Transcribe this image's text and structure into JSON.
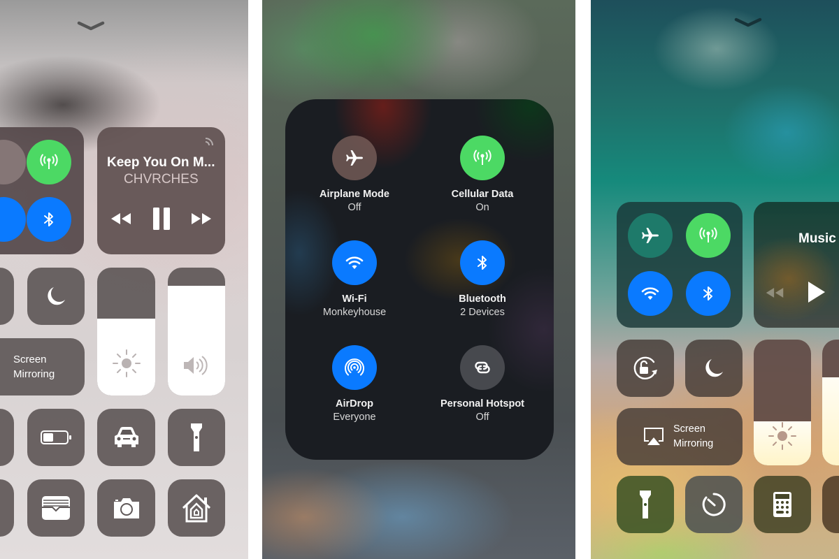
{
  "panels": {
    "left": {
      "connectivity": {
        "cellular_data": {
          "icon": "cellular-antenna-icon",
          "state": "on",
          "color": "#4cd964"
        },
        "bluetooth": {
          "icon": "bluetooth-icon",
          "state": "on",
          "color": "#0a7aff"
        }
      },
      "music": {
        "title": "Keep You On M...",
        "artist": "CHVRCHES",
        "controls": {
          "rewind": "rewind-icon",
          "pause": "pause-icon",
          "fast_forward": "fast-forward-icon",
          "airplay": "airplay-audio-icon"
        }
      },
      "do_not_disturb": {
        "icon": "moon-icon"
      },
      "screen_mirroring": {
        "line1": "Screen",
        "line2": "Mirroring"
      },
      "brightness": {
        "icon": "sun-icon",
        "level_percent": 60
      },
      "volume": {
        "icon": "speaker-icon",
        "level_percent": 86
      },
      "shortcuts": [
        {
          "name": "low-power-mode",
          "icon": "battery-icon"
        },
        {
          "name": "carplay-driving",
          "icon": "car-icon"
        },
        {
          "name": "flashlight",
          "icon": "flashlight-icon"
        },
        {
          "name": "wallet",
          "icon": "wallet-icon"
        },
        {
          "name": "camera",
          "icon": "camera-icon"
        },
        {
          "name": "home",
          "icon": "home-icon"
        }
      ]
    },
    "middle": {
      "items": [
        {
          "name": "Airplane Mode",
          "status": "Off",
          "icon": "airplane-icon",
          "color": "#6b6b70"
        },
        {
          "name": "Cellular Data",
          "status": "On",
          "icon": "cellular-antenna-icon",
          "color": "#4cd964"
        },
        {
          "name": "Wi-Fi",
          "status": "Monkeyhouse",
          "icon": "wifi-icon",
          "color": "#0a7aff"
        },
        {
          "name": "Bluetooth",
          "status": "2 Devices",
          "icon": "bluetooth-icon",
          "color": "#0a7aff"
        },
        {
          "name": "AirDrop",
          "status": "Everyone",
          "icon": "airdrop-icon",
          "color": "#0a7aff"
        },
        {
          "name": "Personal Hotspot",
          "status": "Off",
          "icon": "hotspot-link-icon",
          "color": "#6b6b70"
        }
      ]
    },
    "right": {
      "connectivity": {
        "airplane": {
          "icon": "airplane-icon",
          "state": "off"
        },
        "cellular_data": {
          "icon": "cellular-antenna-icon",
          "state": "on",
          "color": "#4cd964"
        },
        "wifi": {
          "icon": "wifi-icon",
          "state": "on",
          "color": "#0a7aff"
        },
        "bluetooth": {
          "icon": "bluetooth-icon",
          "state": "on",
          "color": "#0a7aff"
        }
      },
      "music": {
        "title": "Music",
        "controls": {
          "rewind": "rewind-icon",
          "play": "play-icon"
        }
      },
      "orientation_lock": {
        "icon": "rotation-lock-icon"
      },
      "do_not_disturb": {
        "icon": "moon-icon"
      },
      "screen_mirroring": {
        "line1": "Screen",
        "line2": "Mirroring",
        "icon": "airplay-screen-icon"
      },
      "brightness": {
        "icon": "sun-icon",
        "level_percent": 35
      },
      "volume": {
        "level_percent": 70
      },
      "shortcuts": [
        {
          "name": "flashlight",
          "icon": "flashlight-icon"
        },
        {
          "name": "timer",
          "icon": "timer-icon"
        },
        {
          "name": "calculator",
          "icon": "calculator-icon"
        }
      ]
    }
  }
}
